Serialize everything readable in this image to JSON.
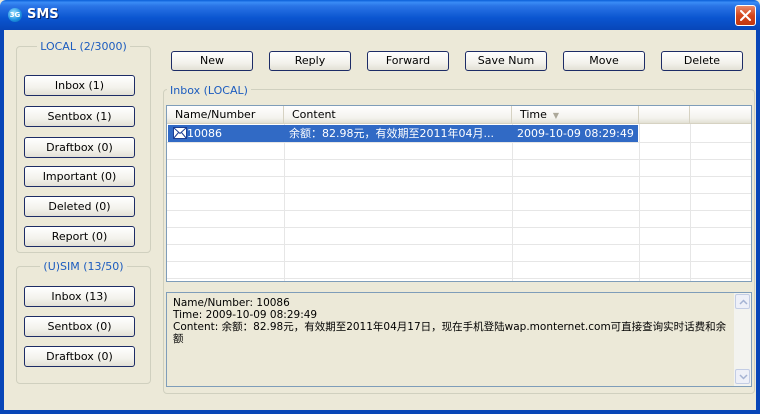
{
  "window": {
    "title": "SMS",
    "app_icon": "3G"
  },
  "local_group": {
    "title": "LOCAL (2/3000)",
    "buttons": [
      {
        "label": "Inbox (1)"
      },
      {
        "label": "Sentbox (1)"
      },
      {
        "label": "Draftbox (0)"
      },
      {
        "label": "Important (0)"
      },
      {
        "label": "Deleted (0)"
      },
      {
        "label": "Report (0)"
      }
    ]
  },
  "sim_group": {
    "title": "(U)SIM (13/50)",
    "buttons": [
      {
        "label": "Inbox (13)"
      },
      {
        "label": "Sentbox (0)"
      },
      {
        "label": "Draftbox (0)"
      }
    ]
  },
  "toolbar": {
    "new": "New",
    "reply": "Reply",
    "forward": "Forward",
    "save_num": "Save Num",
    "move": "Move",
    "delete": "Delete"
  },
  "inbox": {
    "title": "Inbox (LOCAL)",
    "columns": {
      "name": "Name/Number",
      "content": "Content",
      "time": "Time",
      "extra": ""
    },
    "rows": [
      {
        "name": "10086",
        "content": "余额：82.98元，有效期至2011年04月...",
        "time": "2009-10-09 08:29:49",
        "icon": "envelope-icon",
        "selected": true
      }
    ]
  },
  "preview": {
    "line_name": "Name/Number: 10086",
    "line_time": "Time: 2009-10-09 08:29:49",
    "line_content": "Content:  余额：82.98元，有效期至2011年04月17日，现在手机登陆wap.monternet.com可直接查询实时话费和余额"
  },
  "colors": {
    "title_bar": "#0a55d0",
    "selection": "#316ac5",
    "group_title": "#1c5cbf",
    "close": "#d4461c"
  }
}
